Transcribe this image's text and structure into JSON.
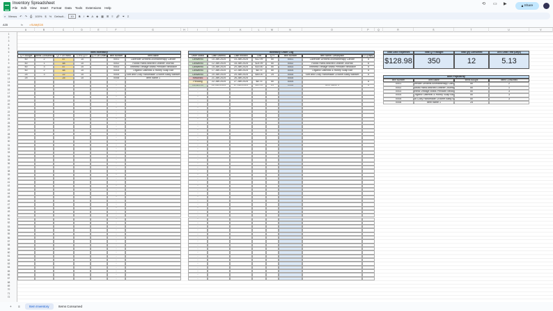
{
  "doc": {
    "title": "Inventory Spreadsheet",
    "menus": [
      "File",
      "Edit",
      "View",
      "Insert",
      "Format",
      "Data",
      "Tools",
      "Extensions",
      "Help"
    ],
    "share": "Share"
  },
  "toolbar": {
    "menus": "Menus",
    "zoom": "100%",
    "font": "Default...",
    "size": "10",
    "b": "B",
    "i": "I",
    "s": "S",
    "a": "A"
  },
  "formula": {
    "ref": "A35",
    "text": "=SUM(E28"
  },
  "inventory": {
    "title": "Item Inventory",
    "headers": [
      "QTY Bought",
      "Items Consumed",
      "QTY On Hand",
      "CTRL QTY",
      "QTY On Order",
      "Item Number",
      "Item Name"
    ],
    "rows": [
      [
        "50",
        "2",
        "47",
        "10",
        "",
        "X001",
        "Lavender Dreams Aromatherapy Candle"
      ],
      [
        "50",
        "1",
        "48",
        "10",
        "",
        "X002",
        "Rustic Hand-stitched Leather Journal"
      ],
      [
        "50",
        "3",
        "47",
        "10",
        "",
        "X003",
        "Timeless Vintage Brass Pendant Necklace"
      ],
      [
        "50",
        "2",
        "48",
        "10",
        "",
        "X004",
        "Organic Oatmeal & Honey Soap Bar"
      ],
      [
        "25",
        "3",
        "22",
        "10",
        "",
        "X005",
        "Soft and Cozy Handmade Crochet Baby Blanket"
      ],
      [
        "25",
        "",
        "25",
        "10",
        "",
        "X006",
        "Item name 1"
      ]
    ]
  },
  "orders": {
    "title": "Inventory Order Log",
    "headers": [
      "Order Status",
      "Date Ordered",
      "Date Recived",
      "Cost",
      "QTY",
      "Item Number",
      "Item Name / Description",
      "LT (Days)"
    ],
    "rows": [
      [
        "Delivered",
        "10-Jan-2025",
        "15-Jan-2025",
        "$12.99",
        "50",
        "X001",
        "Lavender Dreams Aromatherapy Candle",
        "5"
      ],
      [
        "Delivered",
        "12-Jan-2025",
        "18-Jan-2025",
        "$24.99",
        "50",
        "X002",
        "Rustic Hand-stitched Leather Journal",
        "6"
      ],
      [
        "Delivered",
        "15-Jan-2025",
        "20-Jan-2025",
        "$15.50",
        "50",
        "X003",
        "Timeless Vintage Brass Pendant Necklace",
        "5"
      ],
      [
        "Delivered",
        "17-Jan-2025",
        "22-Jan-2025",
        "$8.75",
        "50",
        "X004",
        "Organic Oatmeal & Honey Soap Bar",
        "5"
      ],
      [
        "Delivered",
        "20-Jan-2025",
        "25-Jan-2025",
        "$45.00",
        "25",
        "X005",
        "Soft and Cozy Handmade Crochet Baby Blanket",
        "5"
      ],
      [
        "Returned",
        "21-Jan-2025",
        "26-Jan-2025",
        "",
        "",
        "X005",
        "",
        ""
      ],
      [
        "Pending",
        "22-Jan-2025",
        "27-Jan-2025",
        "$8.75",
        "50",
        "X004",
        "",
        "5"
      ],
      [
        "Delivered",
        "22-Jan-2025",
        "27-Jan-2025",
        "$19.90",
        "25",
        "X006",
        "Item name 1",
        "5"
      ]
    ]
  },
  "kpis": {
    "labels": [
      "Total Cost / Expenses",
      "Total QTY Bought",
      "Total Qty Consumed",
      "AVG Lead Time (Days)"
    ],
    "values": [
      "$128.98",
      "350",
      "12",
      "5.13"
    ]
  },
  "popularity": {
    "title": "Item Popularity",
    "headers": [
      "Item Number",
      "Item Name",
      "Items Bought",
      "Items Consumed"
    ],
    "rows": [
      [
        "X001",
        "Lavender Dreams Aromatherapy Candle",
        "50",
        "2"
      ],
      [
        "X002",
        "Rustic Hand-stitched Leather Journal",
        "50",
        "1"
      ],
      [
        "X003",
        "Timeless Vintage Brass Pendant Necklace",
        "50",
        "3"
      ],
      [
        "X004",
        "Organic Oatmeal & Honey Soap Bar",
        "50",
        "3"
      ],
      [
        "X005",
        "Soft and Cozy Handmade Crochet Baby Blanket",
        "50",
        "3"
      ],
      [
        "X006",
        "Item name 1",
        "25",
        ""
      ]
    ]
  },
  "tabs": [
    "Item Inventory",
    "Items Consumed"
  ],
  "colors": {
    "delivered": "#d9ead3",
    "returned": "#f4cccc",
    "pending": "#fff2cc",
    "header": "#bdd7ee",
    "onhand": "#ffe599",
    "itemcol": "#dbe8f6"
  }
}
